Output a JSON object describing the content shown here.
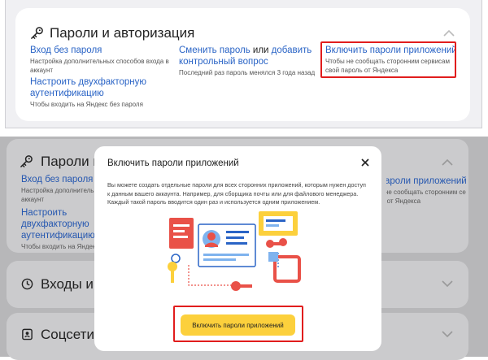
{
  "top_card": {
    "title": "Пароли и авторизация",
    "login_without_password": {
      "link": "Вход без пароля",
      "desc": "Настройка дополнительных способов входа в аккаунт"
    },
    "two_factor": {
      "link": "Настроить двухфакторную аутентификацию",
      "desc": "Чтобы входить на Яндекс без пароля"
    },
    "change_password": {
      "link1": "Сменить пароль",
      "joiner": " или ",
      "link2": "добавить контрольный вопрос",
      "desc": "Последний раз пароль менялся 3 года назад"
    },
    "app_passwords": {
      "link": "Включить пароли приложений",
      "desc": "Чтобы не сообщать сторонним сервисам свой пароль от Яндекса"
    }
  },
  "background": {
    "title_truncated": "Пароли и",
    "login_link": "Вход без пароля",
    "login_desc": "Настройка дополнительных способов входа в аккаунт",
    "two_factor_link": "Настроить двухфакторную аутентификацию",
    "two_factor_desc": "Чтобы входить на Яндекс без пароля",
    "app_passwords_link": "Включить пароли приложений",
    "app_passwords_desc": "Чтобы не сообщать сторонним сервисам свой пароль от Яндекса",
    "logins_title": "Входы и у",
    "social_title": "Соцсети"
  },
  "modal": {
    "title": "Включить пароли приложений",
    "text": "Вы можете создать отдельные пароли для всех сторонних приложений, которым нужен доступ к данным вашего аккаунта. Например, для сборщика почты или для файлового менеджера. Каждый такой пароль вводится один раз и используется одним приложением.",
    "button": "Включить пароли приложений"
  },
  "colors": {
    "link": "#2a64c6",
    "highlight": "#e11d1d",
    "cta": "#fcd03c"
  }
}
